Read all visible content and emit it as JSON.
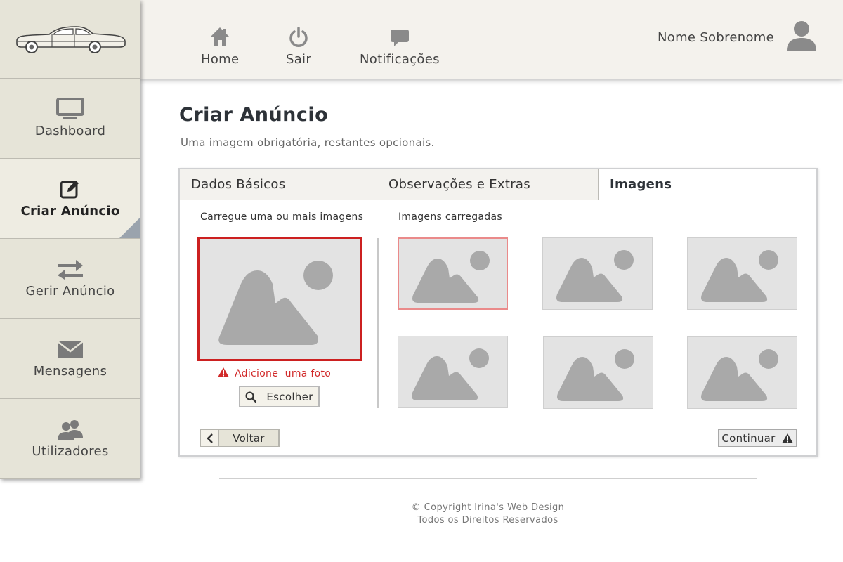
{
  "header": {
    "nav": [
      {
        "label": "Home",
        "icon": "home-icon"
      },
      {
        "label": "Sair",
        "icon": "power-icon"
      },
      {
        "label": "Notificações",
        "icon": "chat-bubble-icon"
      }
    ],
    "user_name": "Nome Sobrenome",
    "user_icon": "user-icon"
  },
  "sidebar": {
    "logo_icon": "car-logo-icon",
    "items": [
      {
        "label": "Dashboard",
        "icon": "monitor-icon",
        "active": false
      },
      {
        "label": "Criar Anúncio",
        "icon": "edit-icon",
        "active": true
      },
      {
        "label": "Gerir Anúncio",
        "icon": "swap-arrows-icon",
        "active": false
      },
      {
        "label": "Mensagens",
        "icon": "envelope-icon",
        "active": false
      },
      {
        "label": "Utilizadores",
        "icon": "users-icon",
        "active": false
      }
    ]
  },
  "main": {
    "title": "Criar Anúncio",
    "subtitle": "Uma imagem obrigatória, restantes opcionais.",
    "tabs": [
      {
        "label": "Dados Básicos",
        "active": false
      },
      {
        "label": "Observações e Extras",
        "active": false
      },
      {
        "label": "Imagens",
        "active": true
      }
    ],
    "upload": {
      "label": "Carregue uma ou mais imagens",
      "warning": "Adicione  uma foto",
      "choose_label": "Escolher"
    },
    "uploaded": {
      "label": "Imagens carregadas",
      "count": 6,
      "selected_index": 0
    },
    "back_label": "Voltar",
    "continue_label": "Continuar"
  },
  "footer": {
    "copyright": "© Copyright Irina's Web Design",
    "rights": "Todos os Direitos Reservados"
  },
  "colors": {
    "sidebar_bg": "#e6e4d8",
    "topbar_bg": "#f4f2ed",
    "error_red": "#cc2020",
    "selected_border": "#ea8a8a",
    "placeholder_gray": "#e3e3e3"
  }
}
